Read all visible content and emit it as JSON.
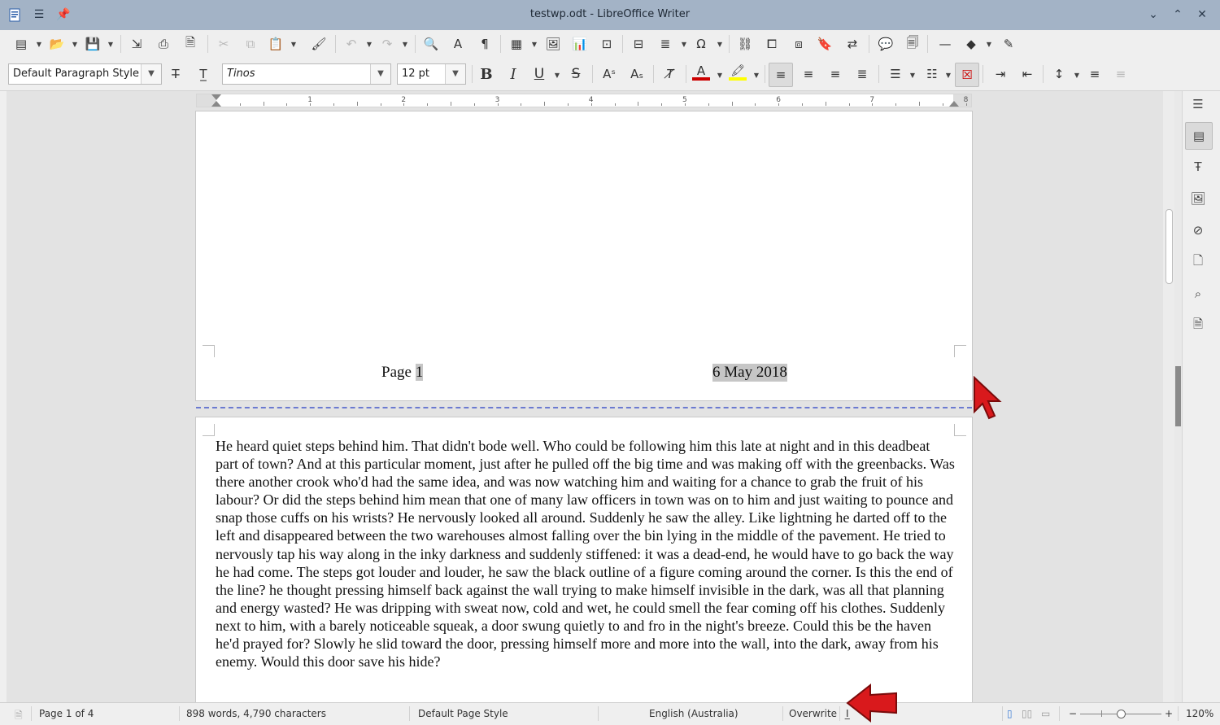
{
  "window": {
    "title": "testwp.odt - LibreOffice Writer",
    "controls": {
      "minimize_icon": "chevron-down-icon",
      "maximize_icon": "chevron-up-icon",
      "close_icon": "close-icon"
    }
  },
  "formatting": {
    "paragraph_style": "Default Paragraph Style",
    "font_name": "Tinos",
    "font_size": "12 pt"
  },
  "document": {
    "page1_footer": {
      "label": "Page",
      "page_number": "1",
      "date": "6 May 2018"
    },
    "page2_text": "He heard quiet steps behind him. That didn't bode well. Who could be following him this late at night and in this deadbeat part of town? And at this particular moment, just after he pulled off the big time and was making off with the greenbacks. Was there another crook who'd had the same idea, and was now watching him and waiting for a chance to grab the fruit of his labour? Or did the steps behind him mean that one of many law officers in town was on to him and just waiting to pounce and snap those cuffs on his wrists? He nervously looked all around. Suddenly he saw the alley. Like lightning he darted off to the left and disappeared between the two warehouses almost falling over the bin lying in the middle of the pavement. He tried to nervously tap his way along in the inky darkness and suddenly stiffened: it was a dead-end, he would have to go back the way he had come. The steps got louder and louder, he saw the black outline of a figure coming around the corner. Is this the end of the line? he thought pressing himself back against the wall trying to make himself invisible in the dark, was all that planning and energy wasted? He was dripping with sweat now, cold and wet, he could smell the fear coming off his clothes. Suddenly next to him, with a barely noticeable squeak, a door swung quietly to and fro in the night's breeze. Could this be the haven he'd prayed for? Slowly he slid toward the door, pressing himself more and more into the wall, into the dark, away from his enemy. Would this door save his hide?"
  },
  "ruler": {
    "numbers": [
      "1",
      "2",
      "3",
      "4",
      "5",
      "6",
      "7",
      "8"
    ]
  },
  "statusbar": {
    "page": "Page 1 of 4",
    "words": "898 words, 4,790 characters",
    "page_style": "Default Page Style",
    "language": "English (Australia)",
    "mode": "Overwrite",
    "zoom": "120%",
    "zoom_minus": "−",
    "zoom_plus": "+"
  },
  "colors": {
    "font_color": "#cc0000",
    "highlight_color": "#ffff00",
    "titlebar": "#a3b3c6"
  }
}
